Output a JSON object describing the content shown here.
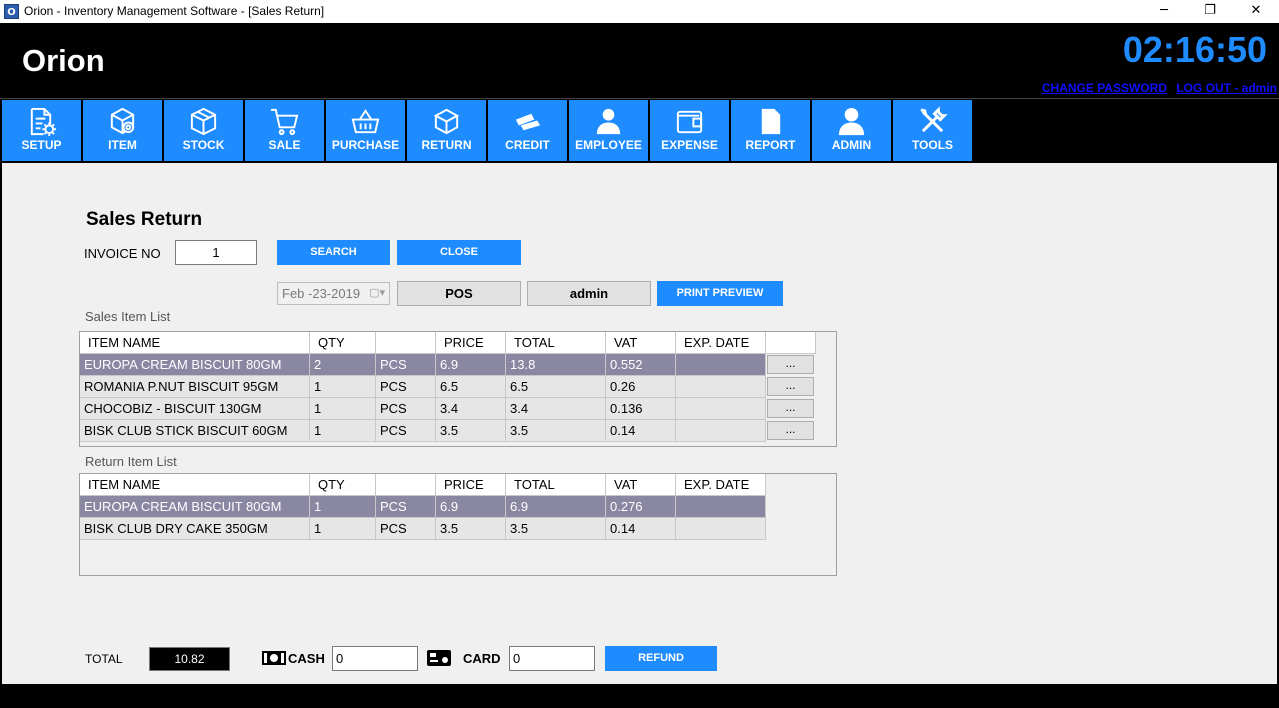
{
  "window": {
    "title": "Orion - Inventory Management Software - [Sales Return]",
    "app_icon_letter": "O",
    "minimize": "─",
    "restore": "❐",
    "close": "✕"
  },
  "header": {
    "brand": "Orion",
    "clock": "02:16:50",
    "change_password": "CHANGE PASSWORD",
    "logout": "LOG OUT - admin"
  },
  "nav": [
    {
      "label": "SETUP",
      "icon": "setup-doc-gear-icon"
    },
    {
      "label": "ITEM",
      "icon": "item-box-icon"
    },
    {
      "label": "STOCK",
      "icon": "stock-box-icon"
    },
    {
      "label": "SALE",
      "icon": "cart-icon"
    },
    {
      "label": "PURCHASE",
      "icon": "basket-icon"
    },
    {
      "label": "RETURN",
      "icon": "return-box-icon"
    },
    {
      "label": "CREDIT",
      "icon": "credit-icon"
    },
    {
      "label": "EMPLOYEE",
      "icon": "employee-icon"
    },
    {
      "label": "EXPENSE",
      "icon": "wallet-icon"
    },
    {
      "label": "REPORT",
      "icon": "report-icon"
    },
    {
      "label": "ADMIN",
      "icon": "admin-user-icon"
    },
    {
      "label": "TOOLS",
      "icon": "tools-icon"
    }
  ],
  "form": {
    "title": "Sales Return",
    "invoice_label": "INVOICE NO",
    "invoice_value": "1",
    "search_label": "SEARCH",
    "close_label": "CLOSE",
    "date_value": "Feb -23-2019",
    "pos_label": "POS",
    "user_label": "admin",
    "print_preview_label": "PRINT PREVIEW",
    "sales_list_label": "Sales Item List",
    "return_list_label": "Return Item List"
  },
  "sales_table": {
    "headers": [
      "ITEM NAME",
      "QTY",
      "",
      "PRICE",
      "TOTAL",
      "VAT",
      "EXP. DATE"
    ],
    "rows": [
      [
        "EUROPA CREAM BISCUIT 80GM",
        "2",
        "PCS",
        "6.9",
        "13.8",
        "0.552",
        ""
      ],
      [
        "ROMANIA P.NUT BISCUIT 95GM",
        "1",
        "PCS",
        "6.5",
        "6.5",
        "0.26",
        ""
      ],
      [
        "CHOCOBIZ - BISCUIT 130GM",
        "1",
        "PCS",
        "3.4",
        "3.4",
        "0.136",
        ""
      ],
      [
        "BISK CLUB STICK BISCUIT 60GM",
        "1",
        "PCS",
        "3.5",
        "3.5",
        "0.14",
        ""
      ]
    ],
    "row_button": "..."
  },
  "return_table": {
    "headers": [
      "ITEM NAME",
      "QTY",
      "",
      "PRICE",
      "TOTAL",
      "VAT",
      "EXP. DATE"
    ],
    "rows": [
      [
        "EUROPA CREAM BISCUIT 80GM",
        "1",
        "PCS",
        "6.9",
        "6.9",
        "0.276",
        ""
      ],
      [
        "BISK CLUB DRY CAKE 350GM",
        "1",
        "PCS",
        "3.5",
        "3.5",
        "0.14",
        ""
      ]
    ]
  },
  "footer": {
    "total_label": "TOTAL",
    "total_value": "10.82",
    "cash_label": "CASH",
    "cash_value": "0",
    "card_label": "CARD",
    "card_value": "0",
    "refund_label": "REFUND"
  },
  "colors": {
    "accent": "#1e8cff",
    "selected_row": "#8a87a3",
    "link": "#1010ff"
  }
}
